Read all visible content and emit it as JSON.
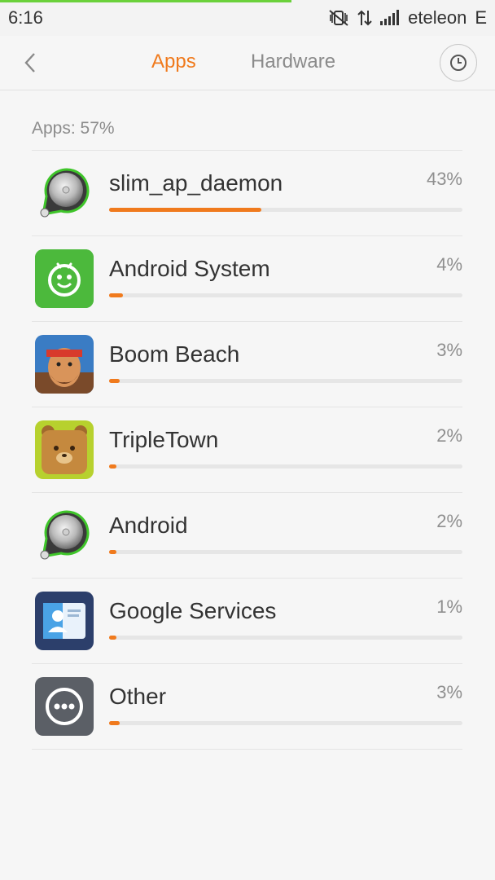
{
  "status_bar": {
    "time": "6:16",
    "carrier": "eteleon",
    "network_type": "E",
    "icons": [
      "vibrate-off-icon",
      "data-transfer-icon",
      "signal-icon"
    ]
  },
  "header": {
    "tabs": [
      {
        "label": "Apps",
        "active": true
      },
      {
        "label": "Hardware",
        "active": false
      }
    ],
    "back_icon": "chevron-left-icon",
    "history_icon": "clock-icon",
    "accent_color": "#f07a1d"
  },
  "section": {
    "label": "Apps: 57%"
  },
  "apps": [
    {
      "name": "slim_ap_daemon",
      "percent_label": "43%",
      "percent": 43,
      "icon": "speaker-pin-icon"
    },
    {
      "name": "Android System",
      "percent_label": "4%",
      "percent": 4,
      "icon": "android-robot-icon"
    },
    {
      "name": "Boom Beach",
      "percent_label": "3%",
      "percent": 3,
      "icon": "boom-beach-icon"
    },
    {
      "name": "TripleTown",
      "percent_label": "2%",
      "percent": 2,
      "icon": "tripletown-bear-icon"
    },
    {
      "name": "Android",
      "percent_label": "2%",
      "percent": 2,
      "icon": "speaker-pin-icon"
    },
    {
      "name": "Google Services",
      "percent_label": "1%",
      "percent": 1,
      "icon": "contact-card-icon"
    },
    {
      "name": "Other",
      "percent_label": "3%",
      "percent": 3,
      "icon": "more-dots-icon"
    }
  ]
}
